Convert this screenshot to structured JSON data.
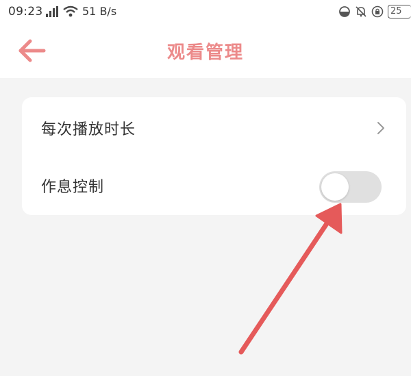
{
  "status_bar": {
    "time": "09:23",
    "network_speed": "51 B/s",
    "battery": "25",
    "icons": [
      "signal-icon",
      "wifi-icon",
      "data-saver-icon",
      "alarm-icon",
      "lock-icon",
      "battery-icon"
    ]
  },
  "header": {
    "title": "观看管理",
    "back_icon": "back-arrow-icon"
  },
  "settings": {
    "items": [
      {
        "label": "每次播放时长",
        "control": "chevron-right-icon"
      },
      {
        "label": "作息控制",
        "control": "toggle",
        "toggle_on": false
      }
    ]
  },
  "colors": {
    "accent": "#ec8a8a",
    "annotation_arrow": "#e55a5a",
    "background": "#f4f4f4",
    "card": "#ffffff",
    "toggle_off": "#e0e0e0"
  }
}
